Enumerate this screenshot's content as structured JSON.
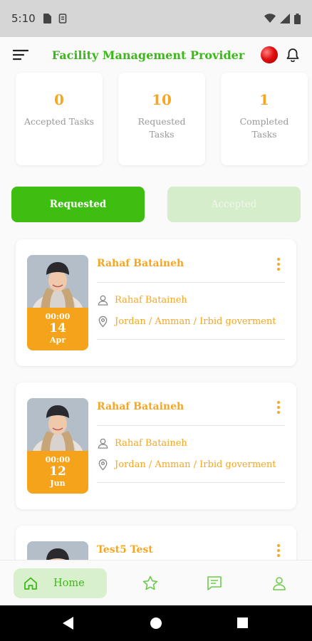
{
  "status": {
    "time": "5:10"
  },
  "header": {
    "title": "Facility Management Provider"
  },
  "stats": [
    {
      "value": "0",
      "label": "Accepted Tasks"
    },
    {
      "value": "10",
      "label": "Requested Tasks"
    },
    {
      "value": "1",
      "label": "Completed Tasks"
    }
  ],
  "segments": {
    "requested": "Requested",
    "accepted": "Accepted"
  },
  "tasks": [
    {
      "name": "Rahaf Bataineh",
      "person": "Rahaf Bataineh",
      "location": "Jordan / Amman / Irbid goverment",
      "time": "00:00",
      "day": "14",
      "month": "Apr"
    },
    {
      "name": "Rahaf Bataineh",
      "person": "Rahaf Bataineh",
      "location": "Jordan / Amman / Irbid goverment",
      "time": "00:00",
      "day": "12",
      "month": "Jun"
    },
    {
      "name": "Test5 Test"
    }
  ],
  "nav": {
    "home_label": "Home"
  },
  "colors": {
    "brand_green": "#3cb81a",
    "accent_orange": "#f5a623",
    "active_segment": "#3ebe10",
    "inactive_segment": "#d5edc8"
  },
  "icons": [
    "menu-icon",
    "bell-icon",
    "person-icon",
    "location-pin-icon",
    "more-vertical-icon",
    "home-icon",
    "star-icon",
    "chat-icon",
    "profile-icon"
  ]
}
